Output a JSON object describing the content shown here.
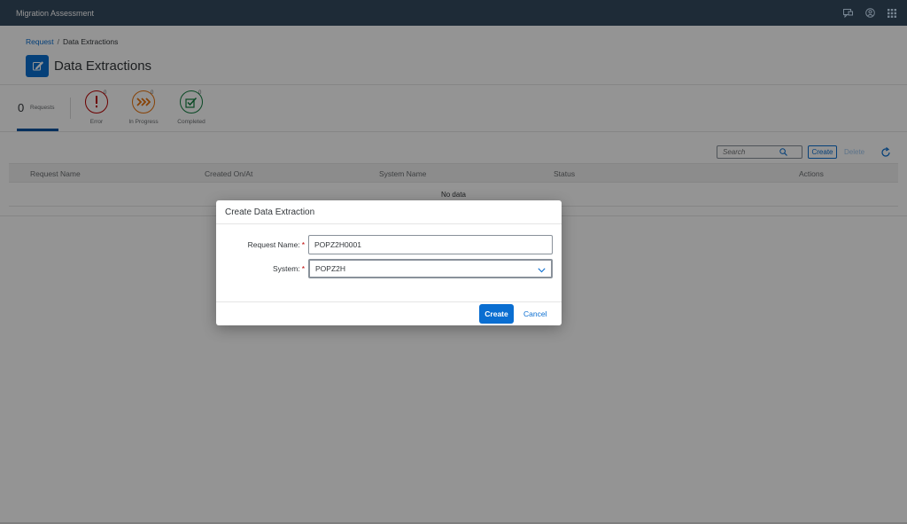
{
  "shell": {
    "title": "Migration Assessment",
    "icons": [
      "feedback-icon",
      "user-icon",
      "app-grid-icon"
    ]
  },
  "breadcrumb": {
    "link": "Request",
    "separator": "/",
    "current": "Data Extractions"
  },
  "page": {
    "title": "Data Extractions",
    "icon": "edit-icon"
  },
  "tabs": {
    "all": {
      "count": "0",
      "label": "Requests"
    },
    "error": {
      "count": "0",
      "label": "Error",
      "color": "#bb0000"
    },
    "in_progress": {
      "count": "0",
      "label": "In Progress",
      "color": "#e9730c"
    },
    "completed": {
      "count": "0",
      "label": "Completed",
      "color": "#107e3e"
    }
  },
  "toolbar": {
    "search_placeholder": "Search",
    "create_label": "Create",
    "delete_label": "Delete"
  },
  "table": {
    "columns": [
      "Request Name",
      "Created On/At",
      "System Name",
      "Status",
      "Actions"
    ],
    "no_data": "No data"
  },
  "dialog": {
    "title": "Create Data Extraction",
    "request_name_label": "Request Name:",
    "request_name_value": "POPZ2H0001",
    "system_label": "System:",
    "system_value": "POPZ2H",
    "required_marker": "*",
    "create_label": "Create",
    "cancel_label": "Cancel"
  },
  "colors": {
    "shell": "#354a5f",
    "accent": "#0a6ed1",
    "required": "#bb0000"
  }
}
